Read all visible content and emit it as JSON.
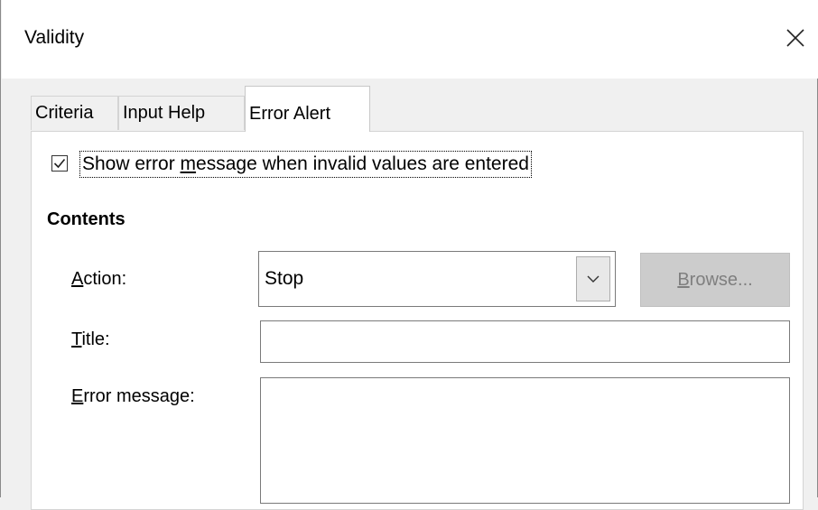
{
  "window": {
    "title": "Validity"
  },
  "tabs": [
    {
      "label": "Criteria"
    },
    {
      "label": "Input Help"
    },
    {
      "label": "Error Alert",
      "active": true
    }
  ],
  "error_alert": {
    "show_checkbox": {
      "checked": true,
      "label_pre": "Show error ",
      "label_mnemonic": "m",
      "label_post": "essage when invalid values are entered"
    },
    "contents_heading": "Contents",
    "action": {
      "label_mnemonic": "A",
      "label_rest": "ction:",
      "value": "Stop"
    },
    "browse_button": {
      "mnemonic": "B",
      "rest": "rowse..."
    },
    "title_field": {
      "label_mnemonic": "T",
      "label_rest": "itle:",
      "value": ""
    },
    "error_message_field": {
      "label_mnemonic": "E",
      "label_rest": "rror message:",
      "value": ""
    }
  },
  "icons": {
    "close": "close-icon",
    "checkbox": "checkmark-icon",
    "dropdown": "chevron-down-icon"
  }
}
